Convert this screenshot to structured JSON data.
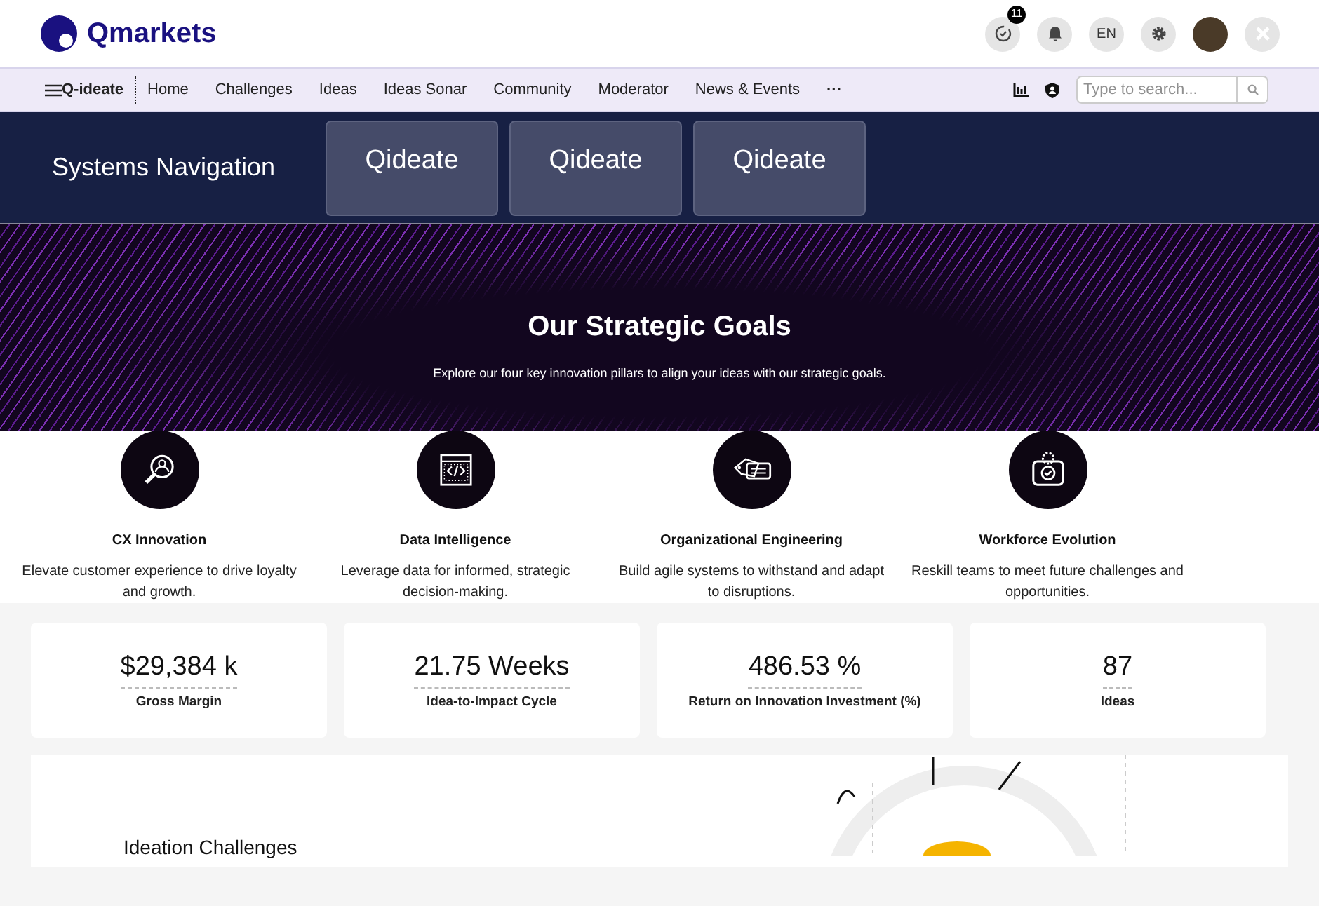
{
  "brand": {
    "name": "Qmarkets"
  },
  "header": {
    "badge_count": "11",
    "language": "EN"
  },
  "nav": {
    "app": "Q-ideate",
    "items": [
      {
        "label": "Home",
        "selected": false
      },
      {
        "label": "Challenges",
        "selected": false
      },
      {
        "label": "Ideas",
        "selected": false
      },
      {
        "label": "Ideas Sonar",
        "selected": false
      },
      {
        "label": "Community",
        "selected": false
      },
      {
        "label": "Moderator",
        "selected": false
      },
      {
        "label": "News & Events",
        "selected": false
      }
    ],
    "more": "···",
    "search": {
      "placeholder": "Type to search..."
    }
  },
  "systems": {
    "title": "Systems Navigation",
    "tiles": [
      "Qideate",
      "Qideate",
      "Qideate"
    ]
  },
  "hero": {
    "title": "Our Strategic Goals",
    "subtitle": "Explore our four key innovation pillars to align your ideas with our strategic goals."
  },
  "pillars": [
    {
      "kind": "magnifier",
      "title": "CX Innovation",
      "text": "Elevate customer experience to drive loyalty and growth."
    },
    {
      "kind": "code",
      "title": "Data Intelligence",
      "text": "Leverage data for informed, strategic decision-making."
    },
    {
      "kind": "tags",
      "title": "Organizational Engineering",
      "text": "Build agile systems to withstand and adapt to disruptions."
    },
    {
      "kind": "gearbag",
      "title": "Workforce Evolution",
      "text": "Reskill teams to meet future challenges and opportunities."
    }
  ],
  "stats": [
    {
      "value": "$29,384 k",
      "label": "Gross Margin"
    },
    {
      "value": "21.75 Weeks",
      "label": "Idea-to-Impact Cycle"
    },
    {
      "value": "486.53 %",
      "label": "Return on Innovation Investment (%)"
    },
    {
      "value": "87",
      "label": "Ideas"
    }
  ],
  "challenges": {
    "title": "Ideation Challenges"
  }
}
